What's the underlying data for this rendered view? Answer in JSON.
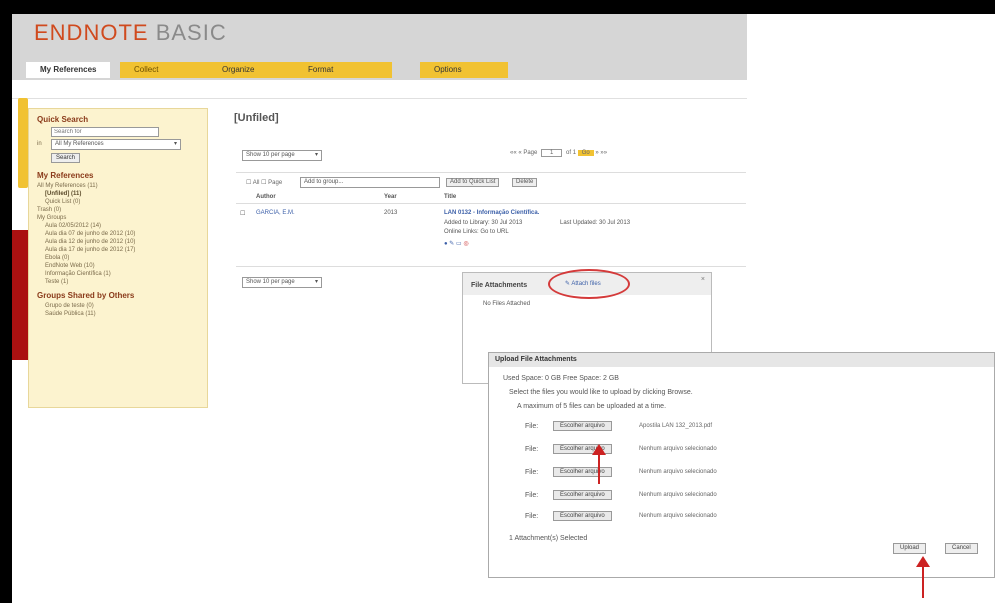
{
  "app": {
    "logo_main": "ENDNOTE",
    "logo_sub": "BASIC"
  },
  "tabs": [
    "My References",
    "Collect",
    "Organize",
    "Format",
    "Options"
  ],
  "sidebar": {
    "vertical_tab": "Quick Search",
    "quick_search": {
      "title": "Quick Search",
      "placeholder": "Search for",
      "in_label": "in",
      "scope": "All My References",
      "button": "Search"
    },
    "my_refs_title": "My References",
    "items": [
      "All My References (11)",
      "[Unfiled] (11)",
      "Quick List (0)",
      "Trash (0)",
      "My Groups",
      "Aula 02/05/2012 (14)",
      "Aula dia 07 de junho de 2012 (10)",
      "Aula dia 12 de junho de 2012 (10)",
      "Aula dia 17 de junho de 2012 (17)",
      "Ebola (0)",
      "EndNote Web (10)",
      "Informação Científica (1)",
      "Teste (1)"
    ],
    "shared_title": "Groups Shared by Others",
    "shared_items": [
      "Grupo de teste (0)",
      "Saúde Pública (11)"
    ]
  },
  "main": {
    "title": "[Unfiled]",
    "show_per_page": "Show 10 per page",
    "pager": {
      "prefix": "«« « Page",
      "page": "1",
      "of": "of 1",
      "go": "Go",
      "suffix": "» »»"
    },
    "toolbar": {
      "all": "All",
      "page": "Page",
      "add_to_group": "Add to group...",
      "add_quick": "Add to Quick List",
      "delete": "Delete"
    },
    "columns": [
      "Author",
      "Year",
      "Title"
    ],
    "row": {
      "author": "GARCIA, E.M.",
      "year": "2013",
      "title": "LAN 0132 - Informação Científica.",
      "added": "Added to Library: 30 Jul 2013",
      "updated": "Last Updated: 30 Jul 2013",
      "online": "Online Links: Go to URL"
    },
    "show_per_page_bottom": "Show 10 per page"
  },
  "attachments": {
    "title": "File Attachments",
    "attach_link": "Attach files",
    "empty": "No Files Attached"
  },
  "upload": {
    "title": "Upload File Attachments",
    "space": "Used Space: 0 GB   Free Space: 2 GB",
    "instr1": "Select the files you would like to upload by clicking Browse.",
    "instr2": "A maximum of 5 files can be uploaded at a time.",
    "file_label": "File:",
    "choose": "Escolher arquivo",
    "files": [
      "Apostila LAN 132_2013.pdf",
      "Nenhum arquivo selecionado",
      "Nenhum arquivo selecionado",
      "Nenhum arquivo selecionado",
      "Nenhum arquivo selecionado"
    ],
    "selected": "1 Attachment(s) Selected",
    "upload_btn": "Upload",
    "cancel_btn": "Cancel"
  },
  "colors": {
    "accent": "#f1c232",
    "brand": "#d04a1e",
    "highlight": "#d43a3a"
  }
}
